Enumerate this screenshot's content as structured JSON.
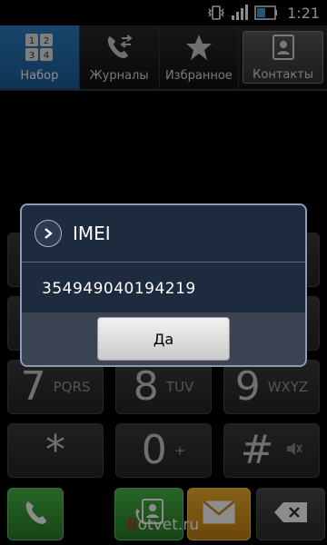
{
  "status_bar": {
    "time": "1:21"
  },
  "tabs": [
    {
      "label": "Набор",
      "icon": "dialpad-icon",
      "active": true
    },
    {
      "label": "Журналы",
      "icon": "call-log-icon",
      "active": false
    },
    {
      "label": "Избранное",
      "icon": "star-icon",
      "active": false
    },
    {
      "label": "Контакты",
      "icon": "contacts-icon",
      "active": false
    }
  ],
  "keypad": {
    "keys": [
      {
        "digit": "7",
        "letters": "PQRS"
      },
      {
        "digit": "8",
        "letters": "TUV"
      },
      {
        "digit": "9",
        "letters": "WXYZ"
      },
      {
        "digit": "*",
        "letters": ""
      },
      {
        "digit": "0",
        "letters": "+"
      },
      {
        "digit": "#",
        "letters": ""
      }
    ]
  },
  "dialog": {
    "title": "IMEI",
    "imei": "354949040194219",
    "ok_label": "Да"
  },
  "watermark": {
    "prefix": "B",
    "text": "otvet.ru"
  },
  "colors": {
    "tab_active": "#2e7fc5",
    "call_green": "#3a9a38",
    "sms_orange": "#e3a020",
    "dialog_bg": "#1e2a3d"
  }
}
